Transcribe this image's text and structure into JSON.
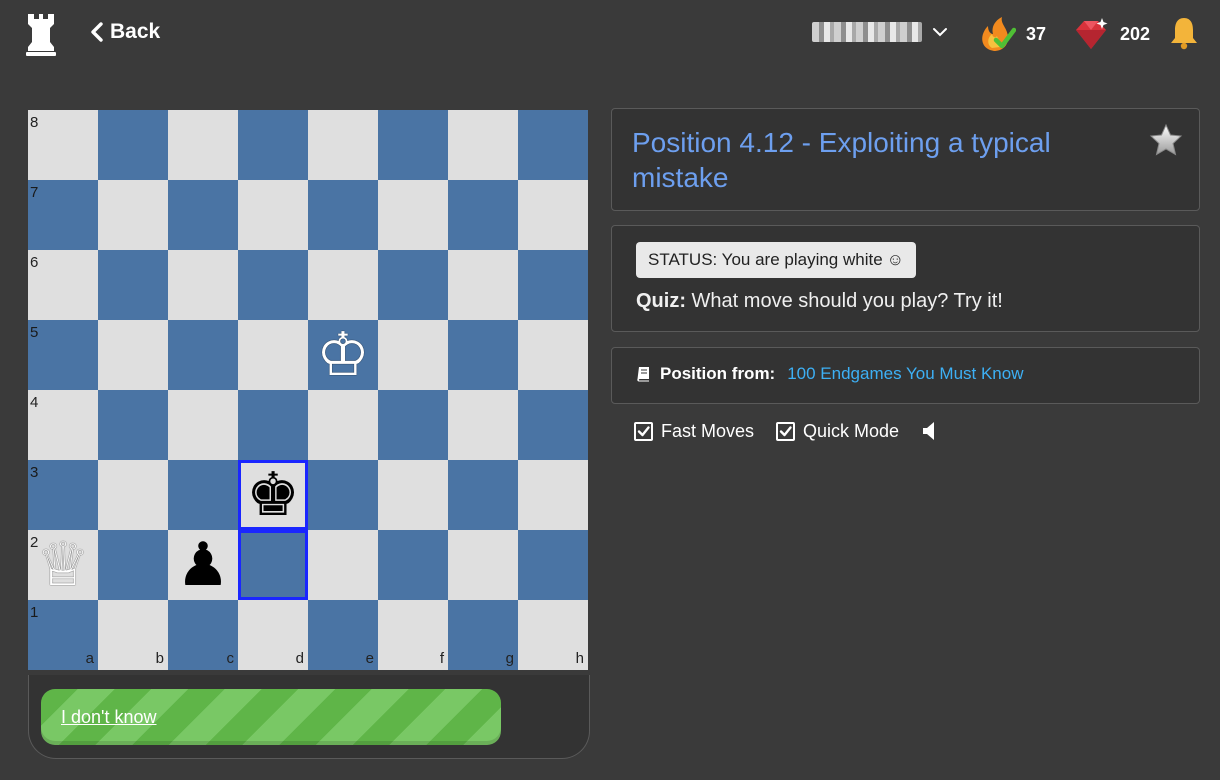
{
  "header": {
    "back_label": "Back",
    "streak_count": "37",
    "gems_count": "202"
  },
  "board": {
    "ranks": [
      "8",
      "7",
      "6",
      "5",
      "4",
      "3",
      "2",
      "1"
    ],
    "files": [
      "a",
      "b",
      "c",
      "d",
      "e",
      "f",
      "g",
      "h"
    ],
    "pieces": [
      {
        "square": "e5",
        "piece": "king",
        "color": "white"
      },
      {
        "square": "d3",
        "piece": "king",
        "color": "black"
      },
      {
        "square": "a2",
        "piece": "queen",
        "color": "white"
      },
      {
        "square": "c2",
        "piece": "pawn",
        "color": "black"
      }
    ],
    "highlighted": [
      "d3",
      "d2"
    ],
    "light_color": "#dfdfdf",
    "dark_color": "#4a74a4",
    "highlight_color": "#1a26ff"
  },
  "actions": {
    "dont_know_label": "I don't know"
  },
  "lesson": {
    "title": "Position 4.12 - Exploiting a typical mistake",
    "status_text": "STATUS: You are playing white",
    "status_emoji": "☺",
    "quiz_label": "Quiz:",
    "quiz_text": " What move should you play? Try it!",
    "source_label": "Position from:",
    "source_link": "100 Endgames You Must Know"
  },
  "options": {
    "fast_moves_label": "Fast Moves",
    "fast_moves_checked": true,
    "quick_mode_label": "Quick Mode",
    "quick_mode_checked": true
  },
  "icons": {
    "logo": "rook-icon",
    "back": "chevron-left-icon",
    "user_menu": "chevron-down-icon",
    "streak": "flame-check-icon",
    "gems": "gem-icon",
    "notifications": "bell-icon",
    "favorite": "star-icon",
    "source": "book-icon",
    "sound": "speaker-icon"
  },
  "colors": {
    "background": "#3a3a3a",
    "title": "#6d9fef",
    "link": "#3db0f5",
    "button_green": "#5fb548"
  }
}
